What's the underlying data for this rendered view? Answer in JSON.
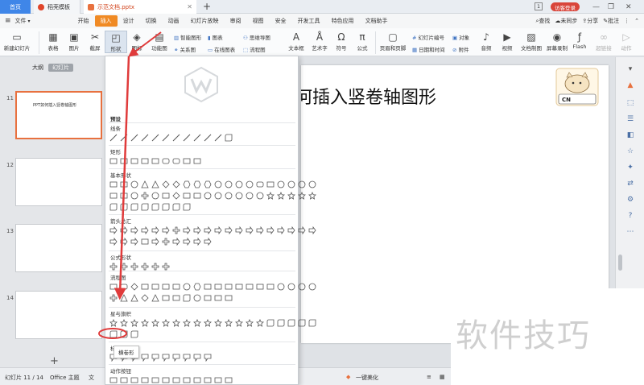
{
  "titlebar": {
    "home_tab": "首页",
    "template_tab": "稻壳模板",
    "doc_tab": "示范文档.pptx",
    "new_tab": "+",
    "page_count": "1",
    "login": "访客登录"
  },
  "menubar": {
    "file": "文件",
    "tabs": [
      "开始",
      "插入",
      "设计",
      "切换",
      "动画",
      "幻灯片放映",
      "审阅",
      "视图",
      "安全",
      "开发工具",
      "特色应用",
      "文档助手"
    ],
    "active_tab": "插入",
    "search": "查找",
    "unsynced": "未同步",
    "share": "分享",
    "comment": "批注"
  },
  "ribbon": {
    "new_slide": "新建幻灯片",
    "table": "表格",
    "picture": "图片",
    "screenshot": "截屏",
    "shape": "形状",
    "icon_lib": "图标",
    "function": "功能图",
    "smart_art": "智能图形",
    "chart": "图表",
    "relation": "关系图",
    "online_chart": "在线图表",
    "mindmap": "思维导图",
    "flowchart": "流程图",
    "textbox": "文本框",
    "art_text": "艺术字",
    "symbol": "符号",
    "formula": "公式",
    "header_footer": "页眉和页脚",
    "slide_number": "幻灯片编号",
    "date_time": "日期和时间",
    "object": "对象",
    "attachment": "附件",
    "audio": "音频",
    "video": "视频",
    "doc_to_ppt": "文档制图",
    "screen_record": "屏幕录制",
    "flash": "Flash",
    "hyperlink": "超链接",
    "action": "动作"
  },
  "leftpanel": {
    "tab_outline": "大纲",
    "tab_slides": "幻灯片",
    "slides": [
      {
        "num": "11",
        "text": "PPT如何插入竖卷轴图形",
        "active": true
      },
      {
        "num": "12",
        "text": "",
        "active": false
      },
      {
        "num": "13",
        "text": "",
        "active": false
      },
      {
        "num": "14",
        "text": "",
        "active": false
      }
    ],
    "add": "+"
  },
  "slide": {
    "title": "何插入竖卷轴图形",
    "badge": "CN"
  },
  "dropdown": {
    "preset": "预设",
    "sections": [
      "线条",
      "矩形",
      "基本形状",
      "箭头总汇",
      "公式形状",
      "流程图",
      "星与旗帜",
      "标注",
      "动作按钮"
    ],
    "tooltip": "横卷形"
  },
  "statusbar": {
    "slide_info": "幻灯片 11 / 14",
    "theme": "Office 主题",
    "beautify": "一键美化",
    "doc_protect": "文"
  },
  "watermark": "软件技巧",
  "colors": {
    "accent_orange": "#f08a24",
    "annotation_red": "#e03b3b",
    "home_blue": "#3f86e8"
  }
}
